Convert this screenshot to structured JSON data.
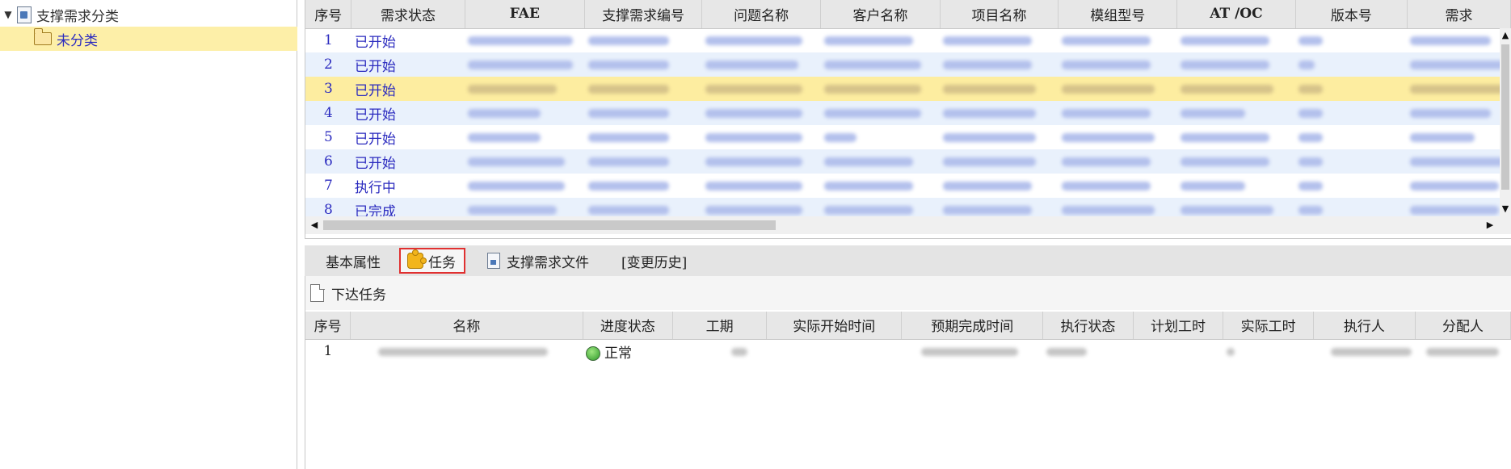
{
  "tree": {
    "root_label": "支撑需求分类",
    "child_label": "未分类",
    "toggle_glyph": "▼"
  },
  "grid": {
    "columns": [
      "序号",
      "需求状态",
      "FAE",
      "支撑需求编号",
      "问题名称",
      "客户名称",
      "项目名称",
      "模组型号",
      "AT /OC",
      "版本号",
      "需求"
    ],
    "rows": [
      {
        "index": "1",
        "status": "已开始"
      },
      {
        "index": "2",
        "status": "已开始"
      },
      {
        "index": "3",
        "status": "已开始"
      },
      {
        "index": "4",
        "status": "已开始"
      },
      {
        "index": "5",
        "status": "已开始"
      },
      {
        "index": "6",
        "status": "已开始"
      },
      {
        "index": "7",
        "status": "执行中"
      },
      {
        "index": "8",
        "status": "已完成"
      }
    ],
    "selected_row": "3"
  },
  "tabs": {
    "basic": "基本属性",
    "tasks": "任务",
    "files": "支撑需求文件",
    "history": "[变更历史]"
  },
  "toolbar": {
    "assign_task": "下达任务"
  },
  "task_grid": {
    "columns": [
      "序号",
      "名称",
      "进度状态",
      "工期",
      "实际开始时间",
      "预期完成时间",
      "执行状态",
      "计划工时",
      "实际工时",
      "执行人",
      "分配人"
    ],
    "rows": [
      {
        "index": "1",
        "progress": "正常"
      }
    ]
  },
  "colors": {
    "selected_row": "#fdeda0",
    "stripe_row": "#e9f1fc",
    "link_text": "#2b2bbf",
    "active_tab_border": "#e03030"
  },
  "icons": {
    "tree_root": "document-icon",
    "tree_child": "folder-icon",
    "task_tab": "puzzle-icon",
    "file_tab": "file-icon",
    "assign": "page-icon",
    "progress": "status-ok-icon"
  }
}
